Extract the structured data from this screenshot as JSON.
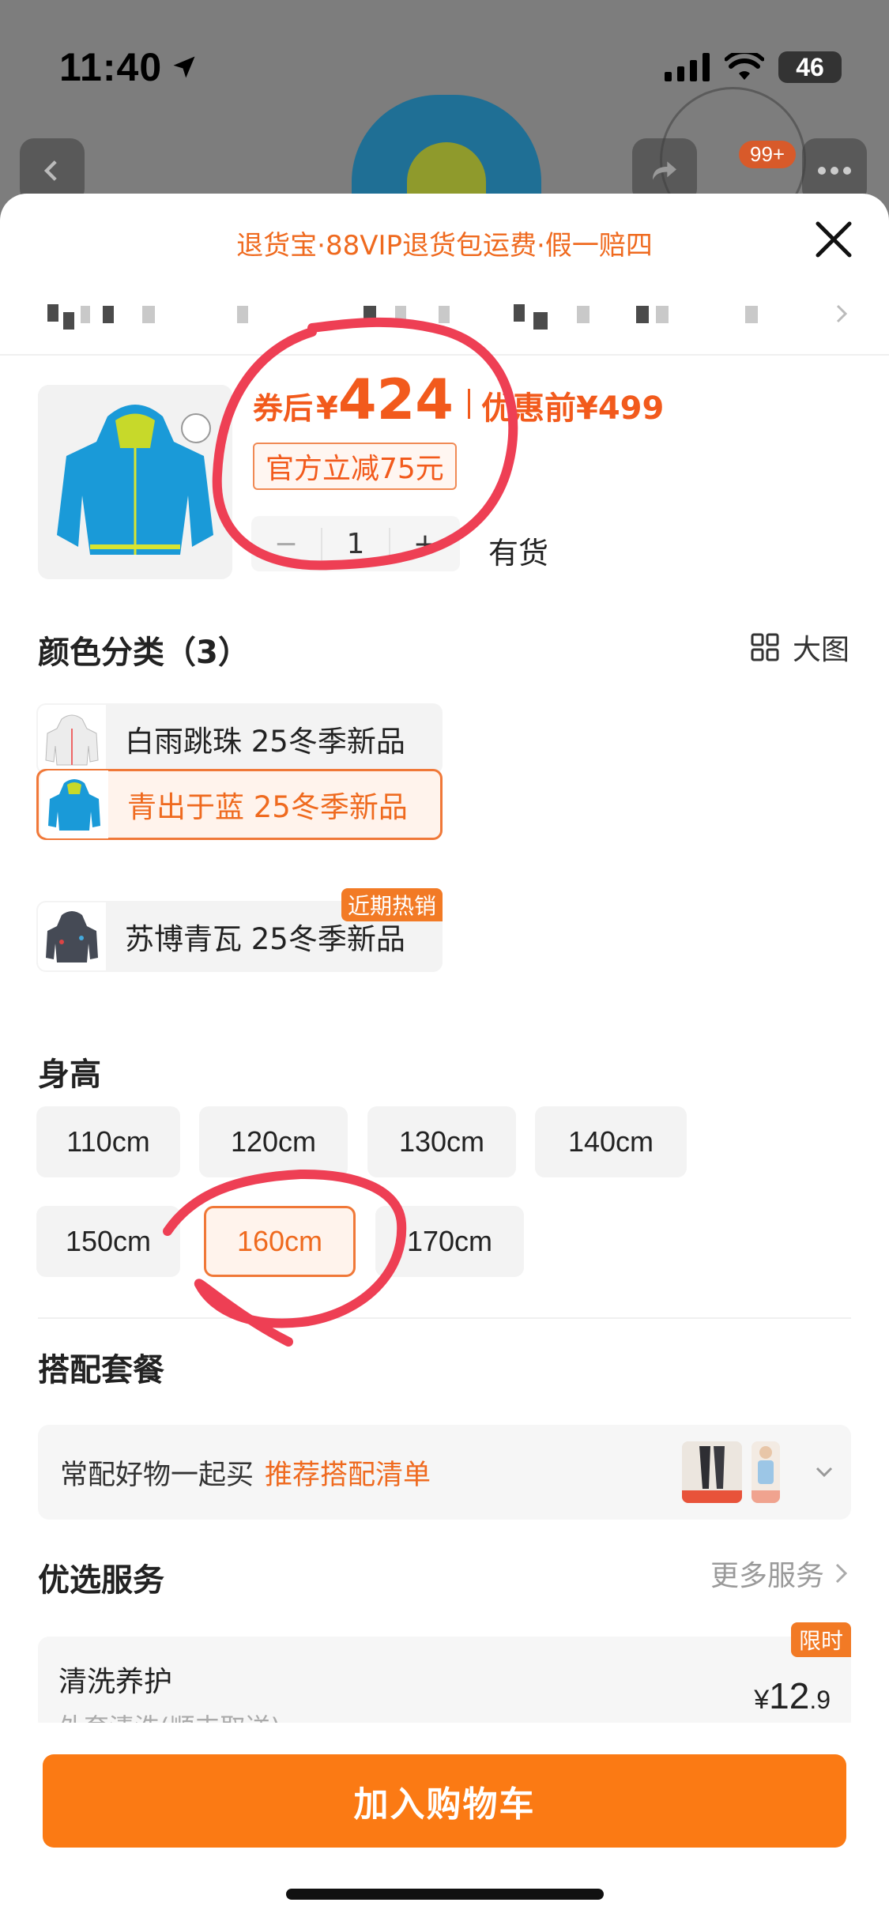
{
  "status_bar": {
    "time": "11:40",
    "battery": "46"
  },
  "background": {
    "cart_badge": "99+"
  },
  "sheet": {
    "promo_text": "退货宝·88VIP退货包运费·假一赔四",
    "product": {
      "price_label": "券后",
      "currency": "¥",
      "price": "424",
      "original_label": "优惠前",
      "original_price": "¥499",
      "discount_tag": "官方立减75元",
      "quantity": "1",
      "qty_minus": "−",
      "qty_plus": "+",
      "stock": "有货"
    },
    "color_section": {
      "title": "颜色分类（3）",
      "big_view": "大图",
      "options": [
        {
          "label": "白雨跳珠 25冬季新品",
          "selected": false
        },
        {
          "label": "青出于蓝 25冬季新品",
          "selected": true
        },
        {
          "label": "苏博青瓦 25冬季新品",
          "selected": false,
          "tag": "近期热销"
        }
      ]
    },
    "size_section": {
      "title": "身高",
      "options": [
        "110cm",
        "120cm",
        "130cm",
        "140cm",
        "150cm",
        "160cm",
        "170cm"
      ],
      "selected": "160cm"
    },
    "combo_section": {
      "title": "搭配套餐",
      "text": "常配好物一起买",
      "link": "推荐搭配清单"
    },
    "service_section": {
      "title": "优选服务",
      "more": "更多服务",
      "item": {
        "name": "清洗养护",
        "desc": "外套清洗(顺丰取送)",
        "tag": "限时",
        "price_currency": "¥",
        "price_int": "12",
        "price_frac": ".9"
      }
    },
    "add_to_cart": "加入购物车"
  },
  "colors": {
    "accent": "#f25a1c",
    "button": "#fb7a14",
    "annotation": "#ee3f54"
  }
}
